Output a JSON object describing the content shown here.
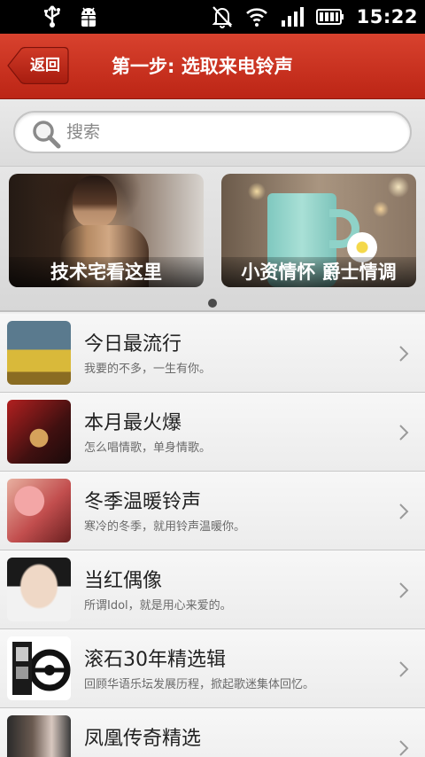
{
  "status_bar": {
    "time": "15:22",
    "icons": [
      "usb-icon",
      "android-debug-icon",
      "alarm-off-icon",
      "wifi-icon",
      "signal-icon",
      "battery-icon"
    ]
  },
  "header": {
    "back_label": "返回",
    "title": "第一步: 选取来电铃声"
  },
  "search": {
    "placeholder": "搜索",
    "value": ""
  },
  "banner": {
    "cards": [
      {
        "caption": "技术宅看这里"
      },
      {
        "caption": "小资情怀 爵士情调"
      }
    ],
    "active_page": 1,
    "page_count": 1
  },
  "list": {
    "items": [
      {
        "name": "今日最流行",
        "desc": "我要的不多，一生有你。"
      },
      {
        "name": "本月最火爆",
        "desc": "怎么唱情歌，单身情歌。"
      },
      {
        "name": "冬季温暖铃声",
        "desc": "寒冷的冬季，就用铃声温暖你。"
      },
      {
        "name": "当红偶像",
        "desc": "所谓Idol，就是用心来爱的。"
      },
      {
        "name": "滚石30年精选辑",
        "desc": "回顾华语乐坛发展历程，掀起歌迷集体回忆。"
      },
      {
        "name": "凤凰传奇精选",
        "desc": ""
      }
    ]
  },
  "colors": {
    "header_red": "#c8301e",
    "background": "#f0f0f0"
  }
}
